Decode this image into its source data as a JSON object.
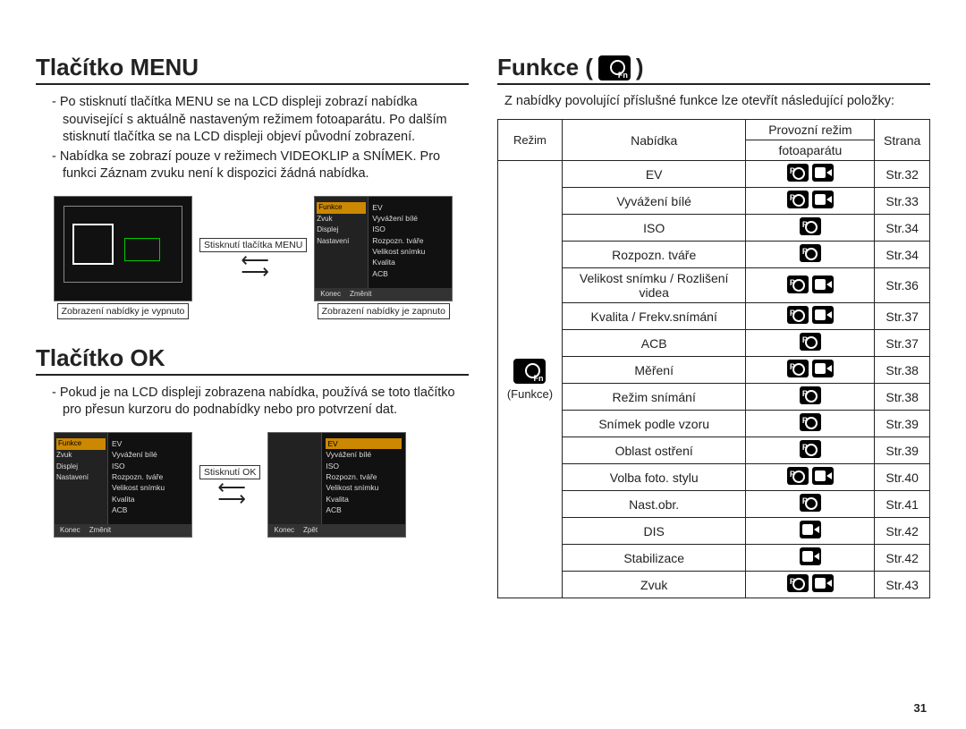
{
  "page_number": "31",
  "left": {
    "h1_menu": "Tlačítko MENU",
    "menu_bullets": [
      "Po stisknutí tlačítka MENU se na LCD displeji zobrazí nabídka související s aktuálně nastaveným režimem fotoaparátu. Po dalším stisknutí tlačítka se na LCD displeji objeví původní zobrazení.",
      "Nabídka se zobrazí pouze v režimech VIDEOKLIP a SNÍMEK. Pro funkci Záznam zvuku není k dispozici žádná nabídka."
    ],
    "mid_label": "Stisknutí tlačítka MENU",
    "caption_left": "Zobrazení nabídky je vypnuto",
    "caption_right": "Zobrazení nabídky je zapnuto",
    "h1_ok": "Tlačítko OK",
    "ok_bullets": [
      "Pokud je na LCD displeji zobrazena nabídka, používá se toto tlačítko pro přesun kurzoru do podnabídky nebo pro potvrzení dat."
    ],
    "ok_mid_label": "Stisknutí OK",
    "menu_sidebar": [
      "Funkce",
      "Zvuk",
      "Displej",
      "Nastavení"
    ],
    "menu_items": [
      "EV",
      "Vyvážení bílé",
      "ISO",
      "Rozpozn. tváře",
      "Velikost snímku",
      "Kvalita",
      "ACB"
    ],
    "menu_foot_left_konec": "Konec",
    "menu_foot_left_zmenit": "Změnit",
    "menu_foot_right_zpet": "Zpět"
  },
  "right": {
    "h1": "Funkce (",
    "h1_close": ")",
    "intro": "Z nabídky povolující příslušné funkce lze otevřít následující položky:",
    "th_rezim": "Režim",
    "th_nabidka": "Nabídka",
    "th_prov1": "Provozní režim",
    "th_prov2": "fotoaparátu",
    "th_strana": "Strana",
    "mode_label": "(Funkce)",
    "rows": [
      {
        "nab": "EV",
        "cam": true,
        "vid": true,
        "page": "Str.32"
      },
      {
        "nab": "Vyvážení bílé",
        "cam": true,
        "vid": true,
        "page": "Str.33"
      },
      {
        "nab": "ISO",
        "cam": true,
        "vid": false,
        "page": "Str.34"
      },
      {
        "nab": "Rozpozn. tváře",
        "cam": true,
        "vid": false,
        "page": "Str.34"
      },
      {
        "nab": "Velikost snímku / Rozlišení videa",
        "cam": true,
        "vid": true,
        "page": "Str.36"
      },
      {
        "nab": "Kvalita / Frekv.snímání",
        "cam": true,
        "vid": true,
        "page": "Str.37"
      },
      {
        "nab": "ACB",
        "cam": true,
        "vid": false,
        "page": "Str.37"
      },
      {
        "nab": "Měření",
        "cam": true,
        "vid": true,
        "page": "Str.38"
      },
      {
        "nab": "Režim snímání",
        "cam": true,
        "vid": false,
        "page": "Str.38"
      },
      {
        "nab": "Snímek podle vzoru",
        "cam": true,
        "vid": false,
        "page": "Str.39"
      },
      {
        "nab": "Oblast ostření",
        "cam": true,
        "vid": false,
        "page": "Str.39"
      },
      {
        "nab": "Volba foto. stylu",
        "cam": true,
        "vid": true,
        "page": "Str.40"
      },
      {
        "nab": "Nast.obr.",
        "cam": true,
        "vid": false,
        "page": "Str.41"
      },
      {
        "nab": "DIS",
        "cam": false,
        "vid": true,
        "page": "Str.42"
      },
      {
        "nab": "Stabilizace",
        "cam": false,
        "vid": true,
        "page": "Str.42"
      },
      {
        "nab": "Zvuk",
        "cam": true,
        "vid": true,
        "page": "Str.43"
      }
    ]
  }
}
